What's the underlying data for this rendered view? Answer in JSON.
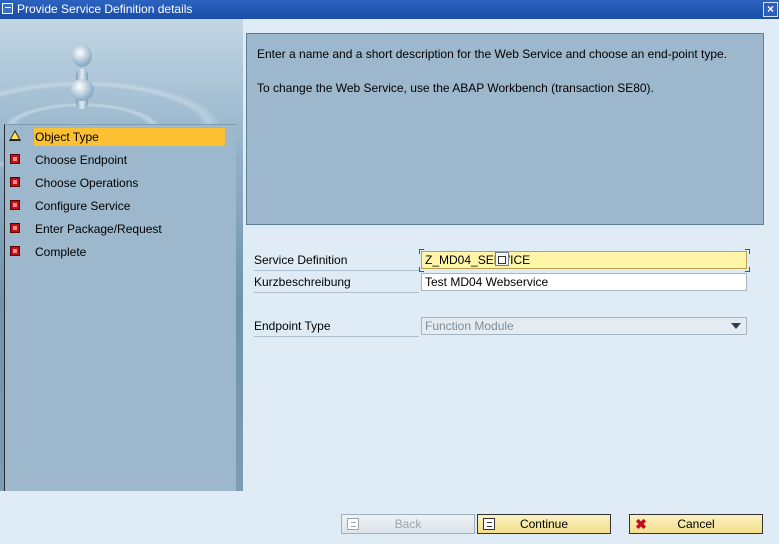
{
  "window": {
    "title": "Provide Service Definition details",
    "close_glyph": "×"
  },
  "steps": [
    {
      "label": "Object Type",
      "status": "warning",
      "active": true
    },
    {
      "label": "Choose Endpoint",
      "status": "error",
      "active": false
    },
    {
      "label": "Choose Operations",
      "status": "error",
      "active": false
    },
    {
      "label": "Configure Service",
      "status": "error",
      "active": false
    },
    {
      "label": "Enter Package/Request",
      "status": "error",
      "active": false
    },
    {
      "label": "Complete",
      "status": "error",
      "active": false
    }
  ],
  "info": {
    "line1": "Enter a name and a short description for the Web Service and choose an end-point type.",
    "line2": "To change the Web Service, use the ABAP Workbench (transaction SE80)."
  },
  "form": {
    "service_definition_label": "Service Definition",
    "service_definition_value": "Z_MD04_SERVICE",
    "short_desc_label": "Kurzbeschreibung",
    "short_desc_value": "Test MD04 Webservice",
    "endpoint_type_label": "Endpoint Type",
    "endpoint_type_value": "Function Module"
  },
  "buttons": {
    "back": "Back",
    "continue": "Continue",
    "cancel": "Cancel"
  },
  "colors": {
    "active_step": "#fbc132",
    "required_field": "#fff5a8",
    "panel": "#9db8cc",
    "background": "#dfebf5"
  },
  "icons": [
    "window-menu-icon",
    "close-icon",
    "warning-icon",
    "error-icon",
    "value-help-icon",
    "dropdown-arrow-icon",
    "document-icon",
    "cancel-icon"
  ]
}
